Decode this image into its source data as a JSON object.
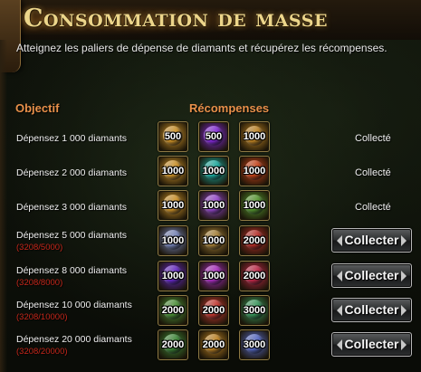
{
  "header": {
    "title": "Consommation de masse",
    "subtitle": "Atteignez les paliers de dépense de diamants et récupérez les récompenses."
  },
  "columns": {
    "objective": "Objectif",
    "rewards": "Récompenses"
  },
  "rows": [
    {
      "objective": "Dépensez 1 000 diamants",
      "progress": "",
      "rewards": [
        {
          "qty": "500",
          "icon": "gold-coin-chest-icon",
          "color": "#d89a2a"
        },
        {
          "qty": "500",
          "icon": "purple-gem-icon",
          "color": "#8a2be2"
        },
        {
          "qty": "1000",
          "icon": "gold-coin-chest-icon",
          "color": "#c98a24"
        }
      ],
      "status": "Collecté",
      "claimable": false
    },
    {
      "objective": "Dépensez 2 000 diamants",
      "progress": "",
      "rewards": [
        {
          "qty": "1000",
          "icon": "gold-coin-chest-icon",
          "color": "#d89a2a"
        },
        {
          "qty": "1000",
          "icon": "teal-crystal-icon",
          "color": "#1bb5a8"
        },
        {
          "qty": "1000",
          "icon": "red-flame-orb-icon",
          "color": "#d2461a"
        }
      ],
      "status": "Collecté",
      "claimable": false
    },
    {
      "objective": "Dépensez 3 000 diamants",
      "progress": "",
      "rewards": [
        {
          "qty": "1000",
          "icon": "gold-coin-chest-icon",
          "color": "#d89a2a"
        },
        {
          "qty": "1000",
          "icon": "purple-gem-icon",
          "color": "#9d4ad8"
        },
        {
          "qty": "1000",
          "icon": "green-scroll-icon",
          "color": "#5aa032"
        }
      ],
      "status": "Collecté",
      "claimable": false
    },
    {
      "objective": "Dépensez 5 000 diamants",
      "progress": "(3208/5000)",
      "rewards": [
        {
          "qty": "1000",
          "icon": "silver-orb-icon",
          "color": "#7d8cc4"
        },
        {
          "qty": "1000",
          "icon": "gold-coin-chest-icon",
          "color": "#b0883a"
        },
        {
          "qty": "2000",
          "icon": "red-white-chest-icon",
          "color": "#c2302a"
        }
      ],
      "status": "Collecter",
      "claimable": true
    },
    {
      "objective": "Dépensez 8 000 diamants",
      "progress": "(3208/8000)",
      "rewards": [
        {
          "qty": "1000",
          "icon": "purple-gem-icon",
          "color": "#6a2ad0"
        },
        {
          "qty": "1000",
          "icon": "purple-gem-icon",
          "color": "#b12ec9"
        },
        {
          "qty": "2000",
          "icon": "red-crystal-icon",
          "color": "#c8284a"
        }
      ],
      "status": "Collecter",
      "claimable": true
    },
    {
      "objective": "Dépensez 10 000 diamants",
      "progress": "(3208/10000)",
      "rewards": [
        {
          "qty": "2000",
          "icon": "green-relic-icon",
          "color": "#4f9a3a"
        },
        {
          "qty": "2000",
          "icon": "red-gem-icon",
          "color": "#d03a32"
        },
        {
          "qty": "3000",
          "icon": "green-rune-icon",
          "color": "#3aa060"
        }
      ],
      "status": "Collecter",
      "claimable": true
    },
    {
      "objective": "Dépensez 20 000 diamants",
      "progress": "(3208/20000)",
      "rewards": [
        {
          "qty": "2000",
          "icon": "green-relic-icon",
          "color": "#3f8f3a"
        },
        {
          "qty": "2000",
          "icon": "gold-coin-chest-icon",
          "color": "#c98a24"
        },
        {
          "qty": "3000",
          "icon": "blue-white-orb-icon",
          "color": "#5a6ed0"
        }
      ],
      "status": "Collecter",
      "claimable": true
    }
  ]
}
